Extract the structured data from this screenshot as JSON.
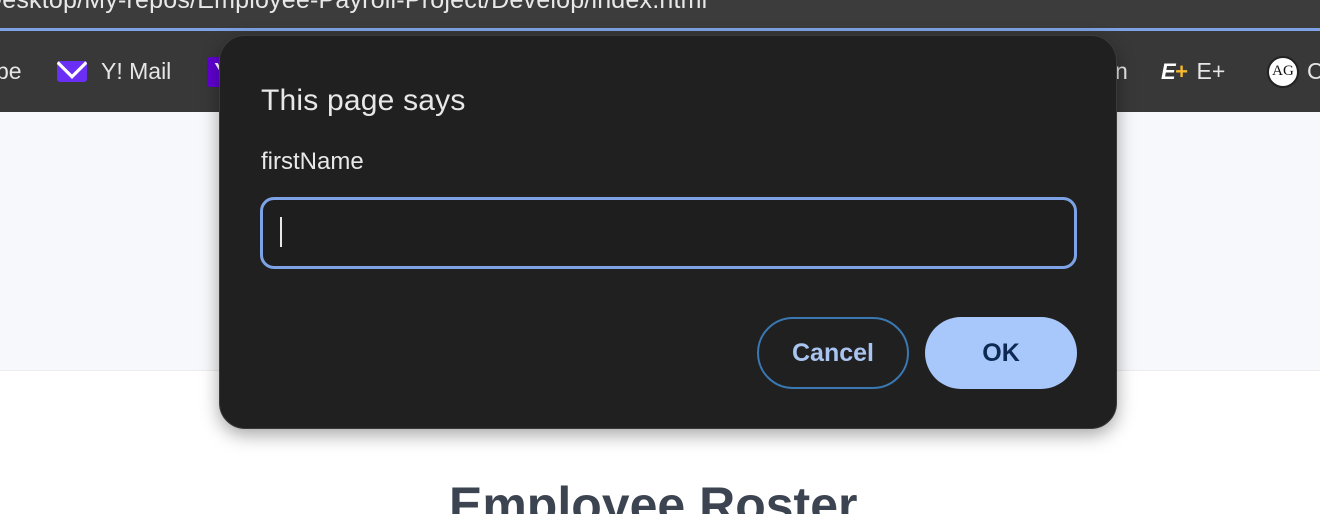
{
  "browser": {
    "address_text": "Desktop/My-repos/Employee-Payroll-Project/Develop/index.html",
    "focus_color": "#7ea2e6",
    "bookmarks": [
      {
        "label": "be",
        "icon": "none"
      },
      {
        "label": "Y! Mail",
        "icon": "mail-icon"
      },
      {
        "label": "Y",
        "icon": "yahoo-icon"
      },
      {
        "label": "n",
        "icon": "none"
      },
      {
        "label": "E+",
        "icon": "eplus-icon"
      },
      {
        "label": "C",
        "icon": "ag-icon"
      }
    ],
    "eplus_glyph": "E",
    "eplus_plus": "+",
    "ag_glyph": "AG"
  },
  "dialog": {
    "title": "This page says",
    "message": "firstName",
    "input_value": "",
    "cancel_label": "Cancel",
    "ok_label": "OK",
    "accent": "#a8c7fa"
  },
  "page": {
    "heading": "Employee Roster"
  }
}
